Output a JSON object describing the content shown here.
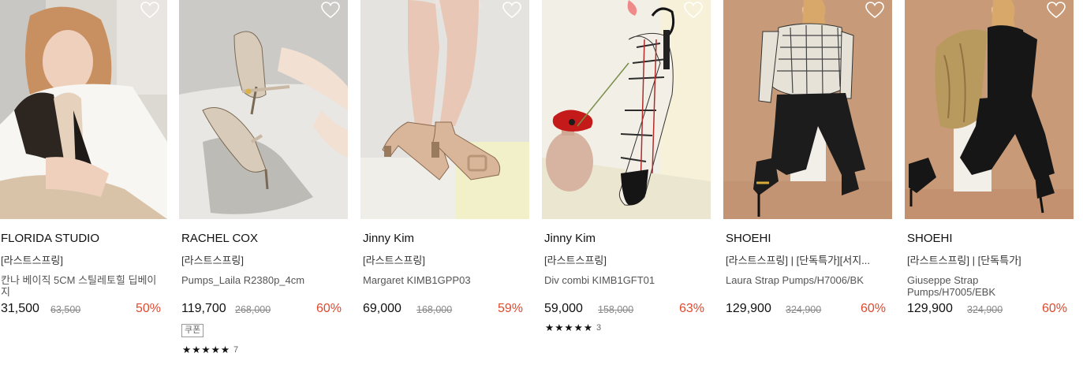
{
  "products": [
    {
      "brand": "FLORIDA STUDIO",
      "tag": "[라스트스프링]",
      "name": "칸나 베이직 5CM 스틸레토힐 딥베이지",
      "price": "31,500",
      "original_price": "63,500",
      "discount": "50%",
      "image_icon": "woman-holding-stiletto-heels-photo",
      "heart_icon": "heart-outline-icon"
    },
    {
      "brand": "RACHEL COX",
      "tag": "[라스트스프링]",
      "name": "Pumps_Laila R2380p_4cm",
      "price": "119,700",
      "original_price": "268,000",
      "discount": "60%",
      "coupon": "쿠폰",
      "stars": "★★★★★",
      "review_count": "7",
      "image_icon": "beige-mary-jane-pumps-photo",
      "heart_icon": "heart-outline-icon"
    },
    {
      "brand": "Jinny Kim",
      "tag": "[라스트스프링]",
      "name": "Margaret KIMB1GPP03",
      "price": "69,000",
      "original_price": "168,000",
      "discount": "59%",
      "image_icon": "beige-buckle-pumps-legs-photo",
      "heart_icon": "heart-outline-icon"
    },
    {
      "brand": "Jinny Kim",
      "tag": "[라스트스프링]",
      "name": "Div combi KIMB1GFT01",
      "price": "59,000",
      "original_price": "158,000",
      "discount": "63%",
      "stars": "★★★★★",
      "review_count": "3",
      "image_icon": "tweed-strap-flats-with-flower-photo",
      "heart_icon": "heart-outline-icon"
    },
    {
      "brand": "SHOEHI",
      "tag": "[라스트스프링] | [단독특가][서지...",
      "name": "Laura Strap Pumps/H7006/BK",
      "price": "129,900",
      "original_price": "324,900",
      "discount": "60%",
      "image_icon": "model-in-tweed-jacket-photo",
      "heart_icon": "heart-outline-icon"
    },
    {
      "brand": "SHOEHI",
      "tag": "[라스트스프링] | [단독특가]",
      "name": "Giuseppe Strap Pumps/H7005/EBK",
      "price": "129,900",
      "original_price": "324,900",
      "discount": "60%",
      "image_icon": "model-in-black-outfit-with-trench-photo",
      "heart_icon": "heart-outline-icon"
    }
  ],
  "colors": {
    "discount": "#e04a2f",
    "price": "#111111",
    "original_price": "#888888"
  }
}
